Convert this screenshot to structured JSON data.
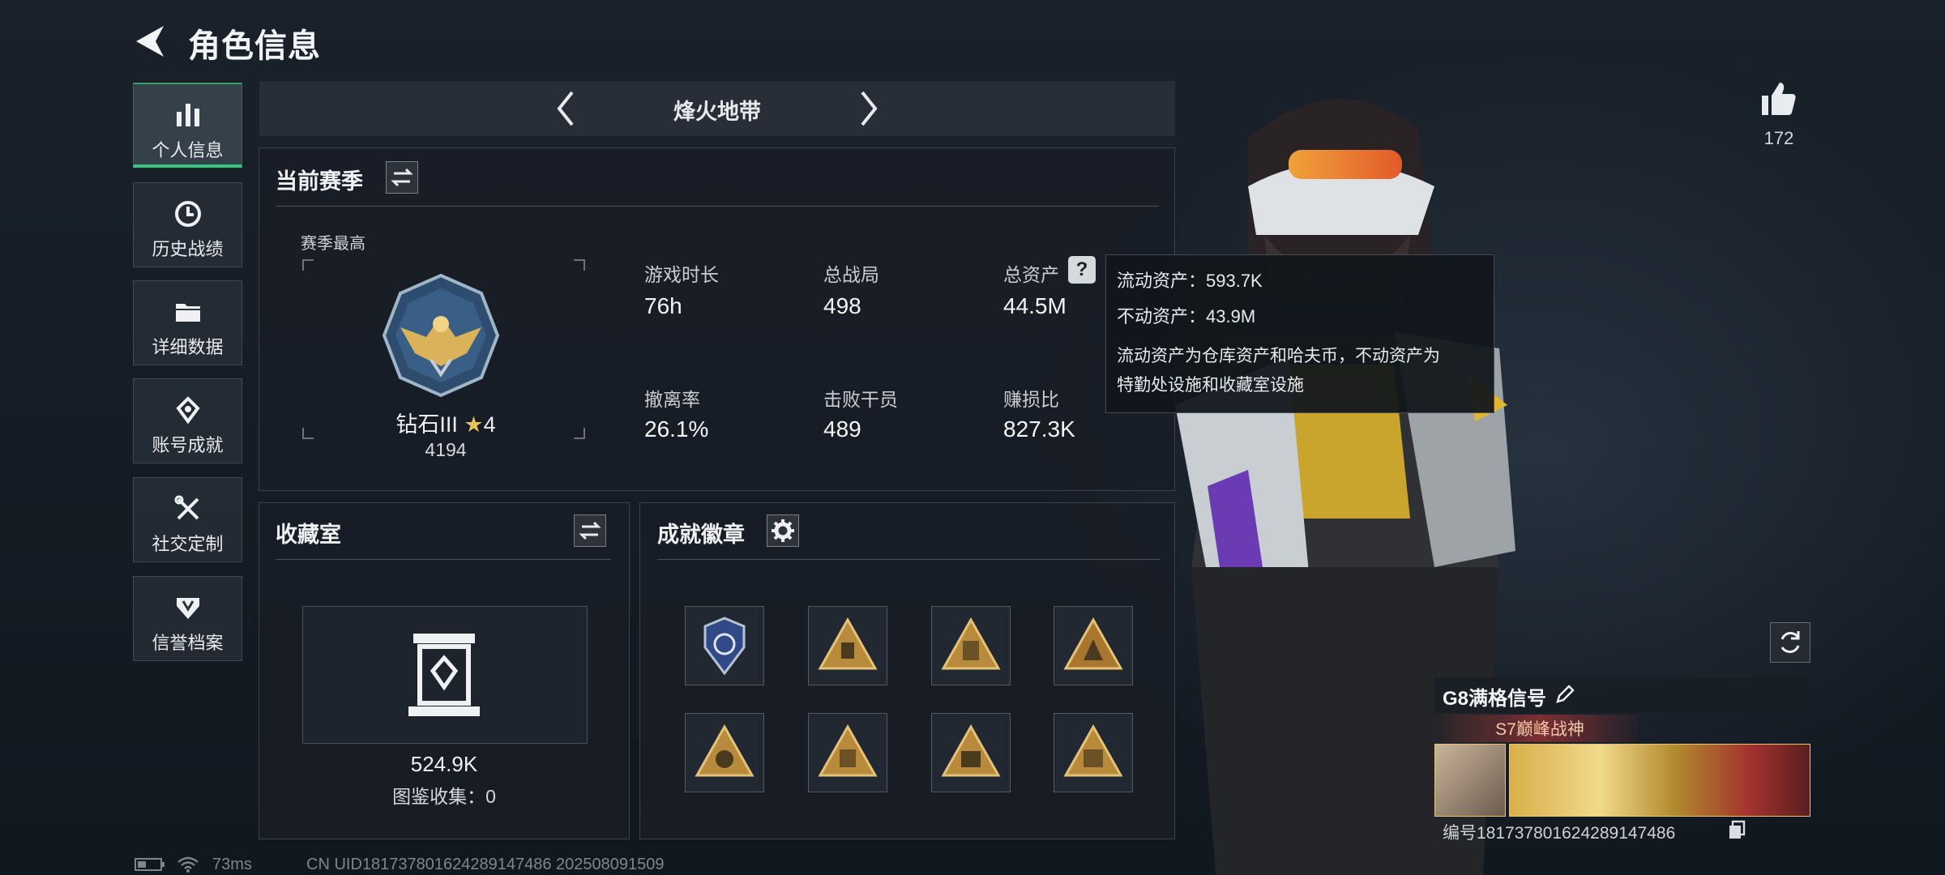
{
  "header": {
    "title": "角色信息"
  },
  "sidebar": {
    "items": [
      {
        "label": "个人信息",
        "icon": "bar-chart-icon",
        "active": true
      },
      {
        "label": "历史战绩",
        "icon": "clock-icon"
      },
      {
        "label": "详细数据",
        "icon": "folder-icon"
      },
      {
        "label": "账号成就",
        "icon": "achievement-icon"
      },
      {
        "label": "社交定制",
        "icon": "tools-icon"
      },
      {
        "label": "信誉档案",
        "icon": "shield-icon"
      }
    ]
  },
  "mode": {
    "name": "烽火地带"
  },
  "season": {
    "title": "当前赛季",
    "best_label": "赛季最高",
    "rank_name": "钻石III",
    "rank_stars": "4",
    "rank_score": "4194",
    "stats": [
      {
        "label": "游戏时长",
        "value": "76h"
      },
      {
        "label": "总战局",
        "value": "498"
      },
      {
        "label": "总资产",
        "value": "44.5M"
      },
      {
        "label": "撤离率",
        "value": "26.1%"
      },
      {
        "label": "击败干员",
        "value": "489"
      },
      {
        "label": "赚损比",
        "value": "827.3K"
      }
    ],
    "help_icon": "?"
  },
  "tooltip": {
    "line1": "流动资产：593.7K",
    "line2": "不动资产：43.9M",
    "line3": "流动资产为仓库资产和哈夫币，不动资产为",
    "line4": "特勤处设施和收藏室设施"
  },
  "collection": {
    "title": "收藏室",
    "value": "524.9K",
    "catalog": "图鉴收集：0"
  },
  "achievements": {
    "title": "成就徽章",
    "badges": [
      "badge-shield-icon",
      "badge-triangle-1-icon",
      "badge-triangle-2-icon",
      "badge-triangle-3-icon",
      "badge-triangle-4-icon",
      "badge-triangle-5-icon",
      "badge-triangle-6-icon",
      "badge-triangle-7-icon"
    ]
  },
  "social": {
    "likes": "172"
  },
  "profile": {
    "name": "G8满格信号",
    "title_badge": "S7巅峰战神",
    "id_line": "编号1817378016242891474​86"
  },
  "status_bar": {
    "ping": "73ms",
    "uid_line": "CN UID1817378016242891474​86 202508091509"
  },
  "colors": {
    "accent": "#33c97a",
    "gold": "#d9b25a",
    "bg": "#141a22"
  }
}
